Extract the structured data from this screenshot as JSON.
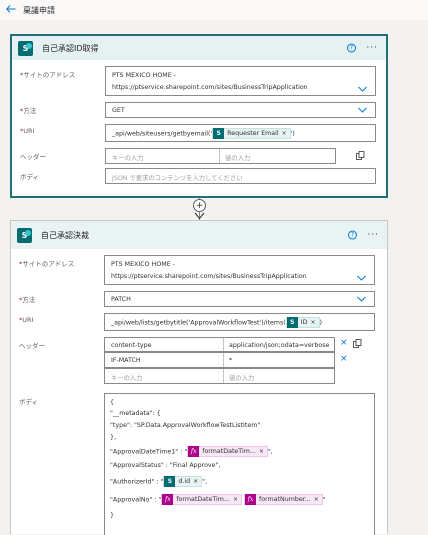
{
  "topbar": {
    "back_icon": "arrow-left-icon",
    "title": "稟議申請"
  },
  "card1": {
    "title": "自己承認ID取得",
    "site_label": "サイトのアドレス",
    "site_line1": "PTS MEXICO HOME -",
    "site_line2": "https://ptservice.sharepoint.com/sites/BusinessTripApplication",
    "method_label": "方法",
    "method_value": "GET",
    "uri_label": "URI",
    "uri_prefix": "_api/web/siteusers/getbyemail('",
    "uri_token": "Requester Email",
    "uri_suffix": "')",
    "header_label": "ヘッダー",
    "header_key_ph": "キーの入力",
    "header_val_ph": "値の入力",
    "body_label": "ボディ",
    "body_ph": "JSON で要求のコンテンツを入力してください"
  },
  "card2": {
    "title": "自己承認決裁",
    "site_label": "サイトのアドレス",
    "site_line1": "PTS MEXICO HOME -",
    "site_line2": "https://ptservice.sharepoint.com/sites/BusinessTripApplication",
    "method_label": "方法",
    "method_value": "PATCH",
    "uri_label": "URI",
    "uri_prefix": "_api/web/lists/getbytitle('ApprovalWorkflowTest')/items(",
    "uri_token": "ID",
    "uri_suffix": ")",
    "header_label": "ヘッダー",
    "headers": [
      {
        "key": "content-type",
        "value": "application/json;odata=verbose"
      },
      {
        "key": "IF-MATCH",
        "value": "*"
      }
    ],
    "header_key_ph": "キーの入力",
    "header_val_ph": "値の入力",
    "body_label": "ボディ",
    "body": {
      "l1": "{",
      "l2": "\"__metadata\": {",
      "l3": "\"type\": \"SP.Data.ApprovalWorkflowTestListItem\"",
      "l4": "},",
      "l5_prefix": "\"ApprovalDateTime1\" : \"",
      "l5_token": "formatDateTim...",
      "l5_suffix": "\",",
      "l6": "\"ApprovalStatus\" : \"Final Approve\",",
      "l7_prefix": "\"AuthorizerId\" : \"",
      "l7_token": "d.id",
      "l7_suffix": "\",",
      "l8_prefix": "\"ApprovalNo\" : \"",
      "l8_token1": "formatDateTim...",
      "l8_token2": "formatNumber...",
      "l8_suffix": "\"",
      "l9": "}"
    }
  },
  "required_mark": "*",
  "close_glyph": "×",
  "add_glyph": "+",
  "sp_letter": "S",
  "fx_glyph": "fx",
  "help_glyph": "?",
  "more_glyph": "···"
}
